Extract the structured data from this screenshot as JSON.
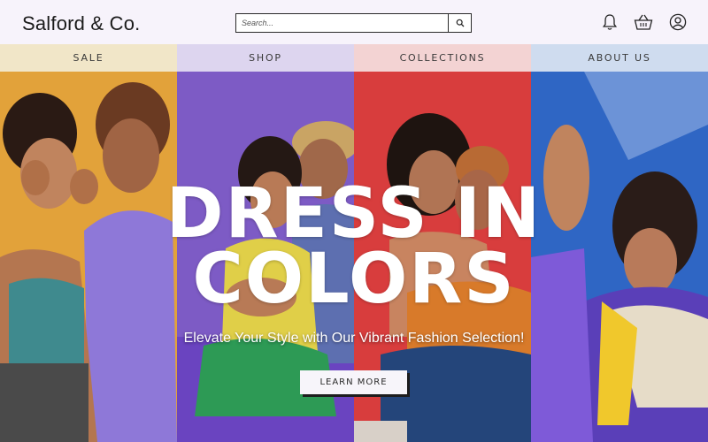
{
  "header": {
    "brand": "Salford & Co.",
    "search_placeholder": "Search...",
    "icons": [
      "search-icon",
      "bell-icon",
      "basket-icon",
      "user-icon"
    ]
  },
  "nav": {
    "items": [
      {
        "label": "SALE",
        "color": "#f1e6c8"
      },
      {
        "label": "SHOP",
        "color": "#ddd5ef"
      },
      {
        "label": "COLLECTIONS",
        "color": "#f3d3d3"
      },
      {
        "label": "ABOUT US",
        "color": "#cfdcef"
      }
    ]
  },
  "hero": {
    "headline_line1": "DRESS IN",
    "headline_line2": "COLORS",
    "subheadline": "Elevate Your Style with Our Vibrant Fashion Selection!",
    "cta_label": "LEARN MORE",
    "panel_colors": [
      "#e2a23a",
      "#7d5bc5",
      "#d83d3d",
      "#2f66c4"
    ]
  }
}
